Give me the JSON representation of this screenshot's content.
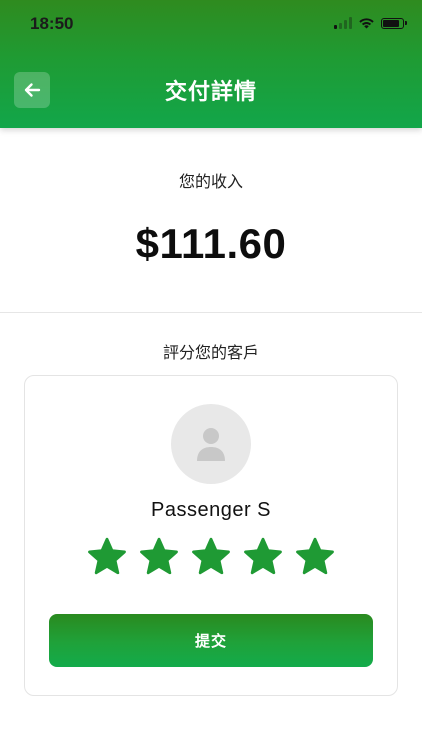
{
  "status_bar": {
    "time": "18:50",
    "icons": [
      "signal-icon",
      "wifi-icon",
      "battery-icon"
    ]
  },
  "header": {
    "title": "交付詳情",
    "back_icon": "arrow-left-icon"
  },
  "income": {
    "label": "您的收入",
    "amount": "$111.60"
  },
  "rating": {
    "label": "評分您的客戶",
    "passenger_name": "Passenger S",
    "avatar_icon": "person-icon",
    "stars_total": 5,
    "stars_selected": 5,
    "submit_label": "提交"
  },
  "colors": {
    "brand_green": "#1a9e3a",
    "star_green": "#1f9a34"
  }
}
